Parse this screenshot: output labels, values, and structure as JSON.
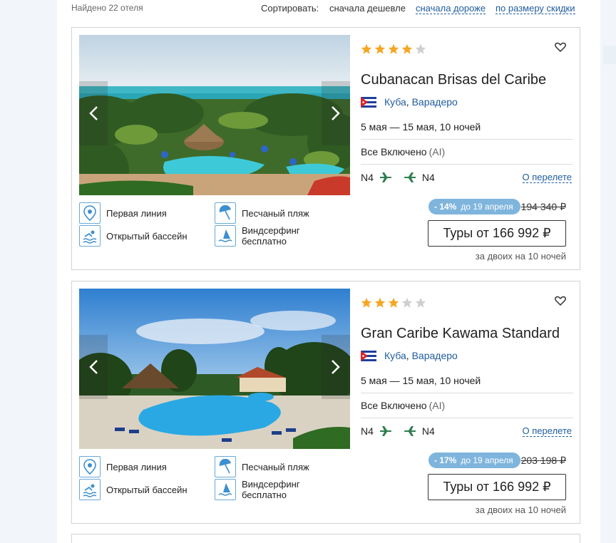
{
  "header": {
    "found": "Найдено 22 отеля",
    "sort_label": "Сортировать:",
    "sort_options": [
      "сначала дешевле",
      "сначала дороже",
      "по размеру скидки"
    ]
  },
  "hotels": [
    {
      "stars": 4,
      "name": "Cubanacan Brisas del Caribe",
      "country": "Куба",
      "city": "Варадеро",
      "dates": "5 мая — 15 мая, 10 ночей",
      "meal": "Все Включено",
      "meal_code": "(AI)",
      "flight_from": "N4",
      "flight_to": "N4",
      "flight_link": "О перелете",
      "discount": "- 14%",
      "discount_until": "до 19 апреля",
      "old_price": "194 340 ₽",
      "price_button": "Туры от 166 992 ₽",
      "price_note": "за двоих на 10 ночей",
      "amenities": [
        "Первая линия",
        "Песчаный пляж",
        "Открытый бассейн",
        "Виндсерфинг бесплатно"
      ]
    },
    {
      "stars": 3,
      "name": "Gran Caribe Kawama Standard",
      "country": "Куба",
      "city": "Варадеро",
      "dates": "5 мая — 15 мая, 10 ночей",
      "meal": "Все Включено",
      "meal_code": "(AI)",
      "flight_from": "N4",
      "flight_to": "N4",
      "flight_link": "О перелете",
      "discount": "- 17%",
      "discount_until": "до 19 апреля",
      "old_price": "203 198 ₽",
      "price_button": "Туры от 166 992 ₽",
      "price_note": "за двоих на 10 ночей",
      "amenities": [
        "Первая линия",
        "Песчаный пляж",
        "Открытый бассейн",
        "Виндсерфинг бесплатно"
      ]
    }
  ],
  "icons": [
    "location-pin-icon",
    "beach-umbrella-icon",
    "swimming-pool-icon",
    "windsurfing-icon",
    "heart-icon",
    "plane-icon",
    "chevron-left-icon",
    "chevron-right-icon",
    "cuba-flag-icon"
  ],
  "colors": {
    "star_on": "#f5a623",
    "star_off": "#cfcfcf",
    "link": "#1f5c9e",
    "discount": "#7fb5dd",
    "plane": "#2e7d4f"
  }
}
